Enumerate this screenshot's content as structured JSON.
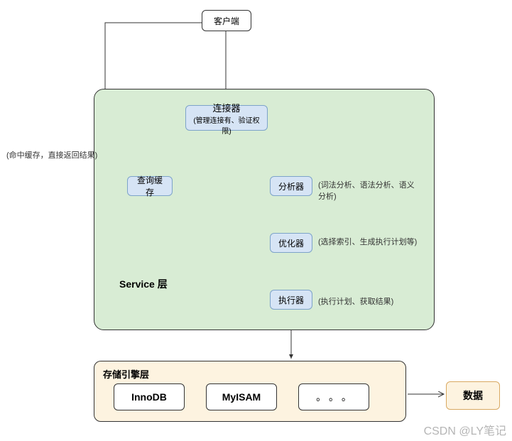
{
  "nodes": {
    "client": "客户端",
    "connector_title": "连接器",
    "connector_sub": "(管理连接有、验证权限)",
    "cache": "查询缓存",
    "analyzer": "分析器",
    "optimizer": "优化器",
    "executor": "执行器"
  },
  "annotations": {
    "cache_hit": "(命中缓存，直接返回结果)",
    "analyzer_note": "(词法分析、语法分析、语义分析)",
    "optimizer_note": "(选择索引、生成执行计划等)",
    "executor_note": "(执行计划、获取结果)"
  },
  "sections": {
    "service": "Service 层",
    "storage": "存储引擎层"
  },
  "engines": {
    "innodb": "InnoDB",
    "myisam": "MyISAM",
    "more": "。 。 。"
  },
  "data_node": "数据",
  "watermark": "CSDN @LY笔记"
}
